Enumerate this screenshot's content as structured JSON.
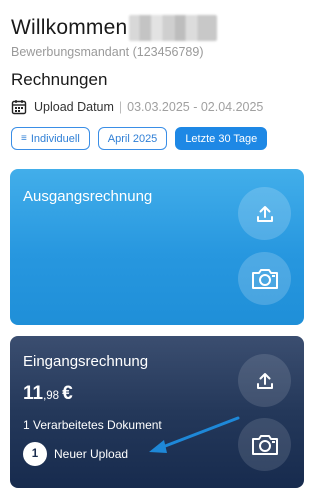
{
  "header": {
    "welcome": "Willkommen",
    "mandant": "Bewerbungsmandant (123456789)",
    "section_title": "Rechnungen",
    "date_label": "Upload Datum",
    "date_separator": "|",
    "date_range": "03.03.2025 - 02.04.2025"
  },
  "filters": [
    {
      "label": "Individuell",
      "icon": "filter-lines-icon",
      "active": false
    },
    {
      "label": "April 2025",
      "active": false
    },
    {
      "label": "Letzte 30 Tage",
      "active": true
    }
  ],
  "cards": {
    "outgoing": {
      "title": "Ausgangsrechnung",
      "upload_icon": "upload-icon",
      "camera_icon": "camera-icon"
    },
    "incoming": {
      "title": "Eingangsrechnung",
      "amount_integer": "11",
      "amount_decimal": ",98",
      "currency": "€",
      "processed": "1 Verarbeitetes Dokument",
      "new_upload_count": "1",
      "new_upload_label": "Neuer Upload",
      "upload_icon": "upload-icon",
      "camera_icon": "camera-icon"
    }
  },
  "colors": {
    "accent": "#1e88e5",
    "outgoing_card": "#2797df",
    "incoming_card": "#24385a",
    "annotation_arrow": "#1e88d8"
  }
}
